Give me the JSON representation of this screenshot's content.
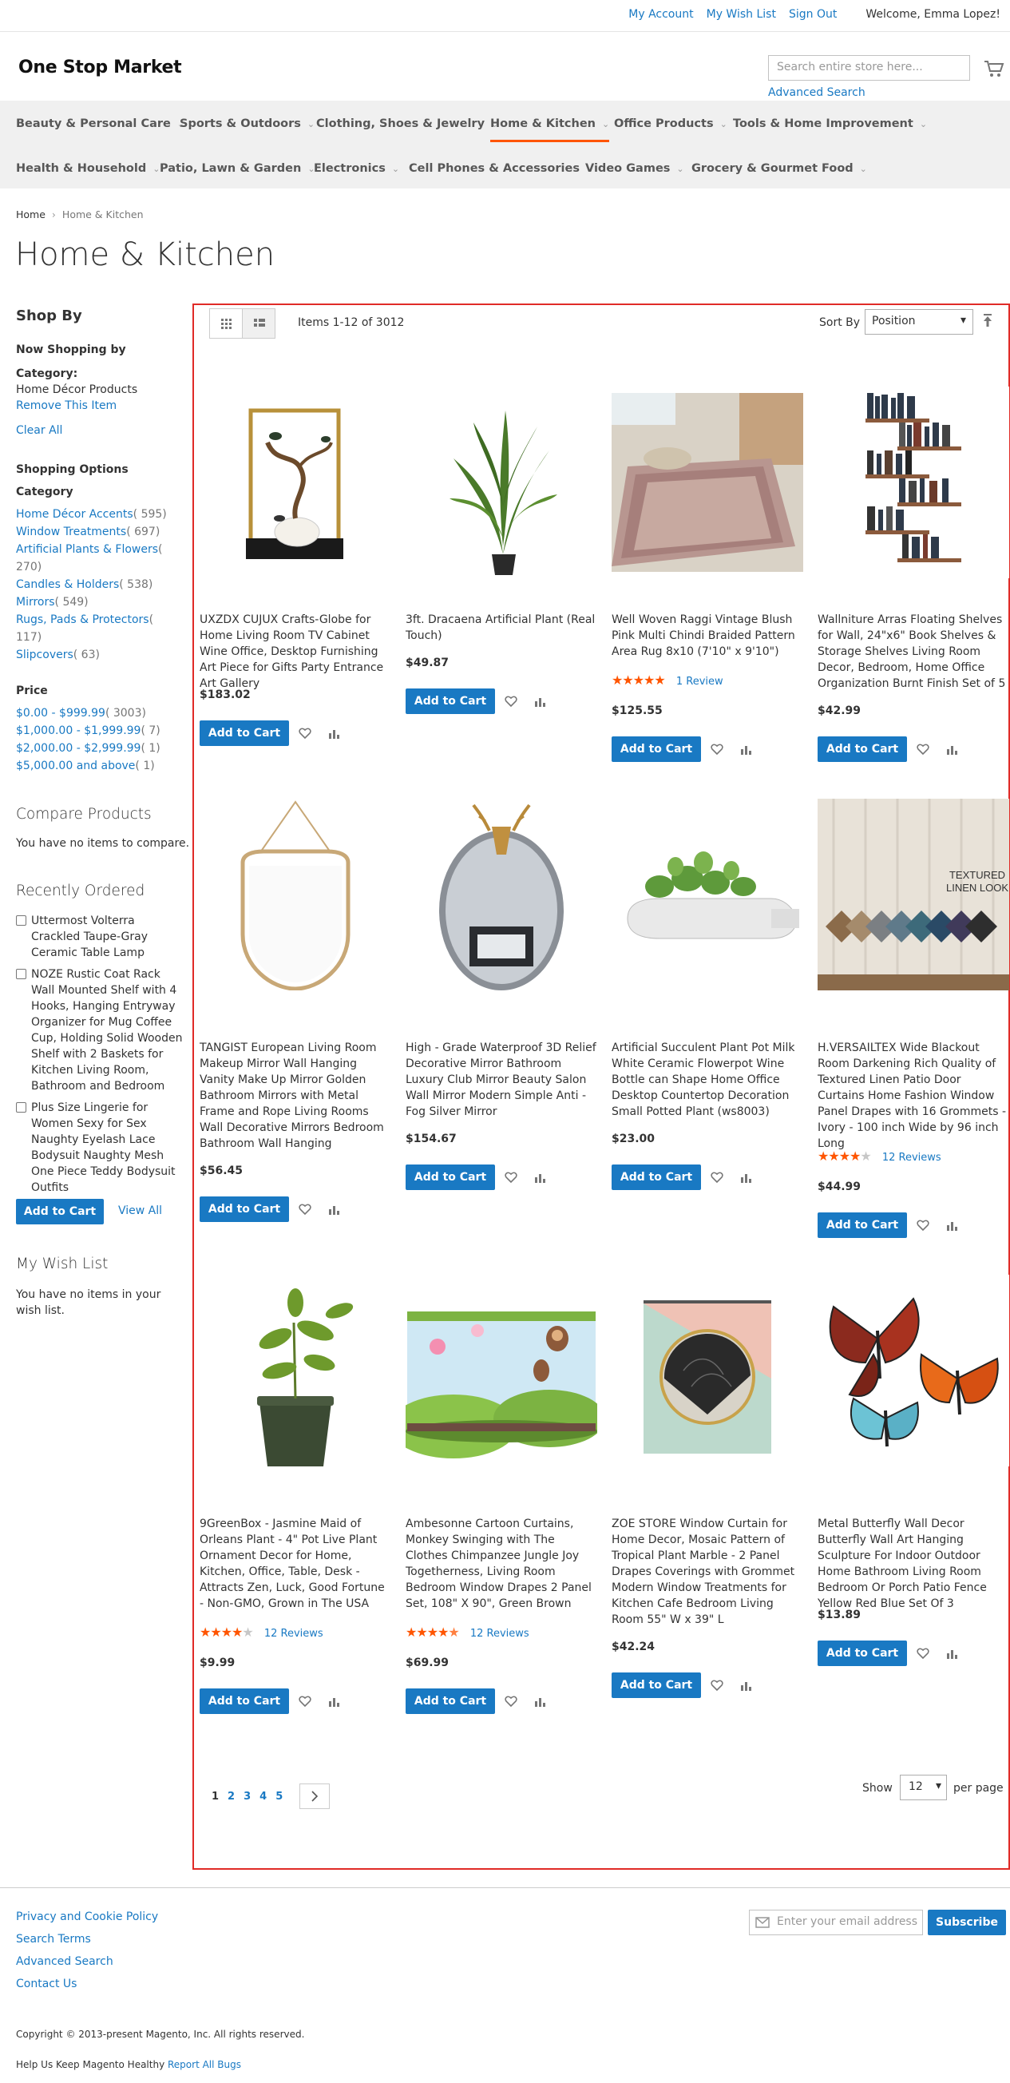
{
  "top": {
    "my_account": "My Account",
    "wish_list": "My Wish List",
    "sign_out": "Sign Out",
    "welcome": "Welcome, Emma Lopez!"
  },
  "header": {
    "logo": "One Stop Market",
    "search_placeholder": "Search entire store here...",
    "advanced_search": "Advanced Search"
  },
  "nav": {
    "items": [
      "Beauty & Personal Care",
      "Sports & Outdoors",
      "Clothing, Shoes & Jewelry",
      "Home & Kitchen",
      "Office Products",
      "Tools & Home Improvement",
      "Health & Household",
      "Patio, Lawn & Garden",
      "Electronics",
      "Cell Phones & Accessories",
      "Video Games",
      "Grocery & Gourmet Food"
    ],
    "active": "Home & Kitchen"
  },
  "breadcrumb": {
    "home": "Home",
    "sep": "›",
    "current": "Home & Kitchen"
  },
  "page_title": "Home & Kitchen",
  "sidebar": {
    "shop_by": "Shop By",
    "now_shopping": "Now Shopping by",
    "category_label": "Category:",
    "category_value": "Home Décor Products",
    "remove": "Remove This Item",
    "clear_all": "Clear All",
    "shopping_options": "Shopping Options",
    "category": "Category",
    "categories": [
      {
        "name": "Home Décor Accents",
        "count": "( 595)"
      },
      {
        "name": "Window Treatments",
        "count": "( 697)"
      },
      {
        "name": "Artificial Plants & Flowers",
        "count": "(",
        "count2": "270)"
      },
      {
        "name": "Candles & Holders",
        "count": "( 538)"
      },
      {
        "name": "Mirrors",
        "count": "( 549)"
      },
      {
        "name": "Rugs, Pads & Protectors",
        "count": "(",
        "count2": "117)"
      },
      {
        "name": "Slipcovers",
        "count": "( 63)"
      }
    ],
    "price": "Price",
    "prices": [
      {
        "name": "$0.00 - $999.99",
        "count": "( 3003)"
      },
      {
        "name": "$1,000.00 - $1,999.99",
        "count": "( 7)"
      },
      {
        "name": "$2,000.00 - $2,999.99",
        "count": "( 1)"
      },
      {
        "name": "$5,000.00 and above",
        "count": "( 1)"
      }
    ],
    "compare_title": "Compare Products",
    "compare_empty": "You have no items to compare.",
    "recent_title": "Recently Ordered",
    "recent_items": [
      "Uttermost Volterra Crackled Taupe-Gray Ceramic Table Lamp",
      "NOZE Rustic Coat Rack Wall Mounted Shelf with 4 Hooks, Hanging Entryway Organizer for Mug Coffee Cup, Holding Solid Wooden Shelf with 2 Baskets for Kitchen Living Room, Bathroom and Bedroom",
      "Plus Size Lingerie for Women Sexy for Sex Naughty Eyelash Lace Bodysuit Naughty Mesh One Piece Teddy Bodysuit Outfits"
    ],
    "add_to_cart": "Add to Cart",
    "view_all": "View All",
    "wish_title": "My Wish List",
    "wish_empty": "You have no items in your wish list."
  },
  "toolbar": {
    "items_count": "Items 1-12 of 3012",
    "sort_by": "Sort By",
    "sort_value": "Position",
    "show": "Show",
    "limit": "12",
    "per_page": "per page",
    "pages": [
      "1",
      "2",
      "3",
      "4",
      "5"
    ]
  },
  "products": [
    {
      "name": "UXZDX CUJUX Crafts-Globe for Home Living Room TV Cabinet Wine Office, Desktop Furnishing Art Piece for Gifts Party Entrance Art Gallery",
      "price": "$183.02",
      "rating": 0,
      "reviews": ""
    },
    {
      "name": "3ft. Dracaena Artificial Plant (Real Touch)",
      "price": "$49.87",
      "rating": 0,
      "reviews": ""
    },
    {
      "name": "Well Woven Raggi Vintage Blush Pink Multi Chindi Braided Pattern Area Rug 8x10 (7'10\" x 9'10\")",
      "price": "$125.55",
      "rating": 5,
      "reviews": "1  Review"
    },
    {
      "name": "Wallniture Arras Floating Shelves for Wall, 24\"x6\" Book Shelves & Storage Shelves Living Room Decor, Bedroom, Home Office Organization Burnt Finish Set of 5",
      "price": "$42.99",
      "rating": 0,
      "reviews": ""
    },
    {
      "name": "TANGIST European Living Room Makeup Mirror Wall Hanging Vanity Make Up Mirror Golden Bathroom Mirrors with Metal Frame and Rope Living Rooms Wall Decorative Mirrors Bedroom Bathroom Wall Hanging",
      "price": "$56.45",
      "rating": 0,
      "reviews": ""
    },
    {
      "name": "High - Grade Waterproof 3D Relief Decorative Mirror Bathroom Luxury Club Mirror Beauty Salon Wall Mirror Modern Simple Anti - Fog Silver Mirror",
      "price": "$154.67",
      "rating": 0,
      "reviews": ""
    },
    {
      "name": "Artificial Succulent Plant Pot Milk White Ceramic Flowerpot Wine Bottle can Shape Home Office Desktop Countertop Decoration Small Potted Plant (ws8003)",
      "price": "$23.00",
      "rating": 0,
      "reviews": ""
    },
    {
      "name": "H.VERSAILTEX Wide Blackout Room Darkening Rich Quality of Textured Linen Patio Door Curtains Home Fashion Window Panel Drapes with 16 Grommets - Ivory - 100 inch Wide by 96 inch Long",
      "price": "$44.99",
      "rating": 4,
      "reviews": "12  Reviews"
    },
    {
      "name": "9GreenBox - Jasmine Maid of Orleans Plant - 4\" Pot Live Plant Ornament Decor for Home, Kitchen, Office, Table, Desk - Attracts Zen, Luck, Good Fortune - Non-GMO, Grown in The USA",
      "price": "$9.99",
      "rating": 4,
      "reviews": "12  Reviews"
    },
    {
      "name": "Ambesonne Cartoon Curtains, Monkey Swinging with The Clothes Chimpanzee Jungle Joy Togetherness, Living Room Bedroom Window Drapes 2 Panel Set, 108\" X 90\", Green Brown",
      "price": "$69.99",
      "rating": 4.5,
      "reviews": "12  Reviews"
    },
    {
      "name": "ZOE STORE Window Curtain for Home Decor, Mosaic Pattern of Tropical Plant Marble - 2 Panel Drapes Coverings with Grommet Modern Window Treatments for Kitchen Cafe Bedroom Living Room 55\" W x 39\" L",
      "price": "$42.24",
      "rating": 0,
      "reviews": ""
    },
    {
      "name": "Metal Butterfly Wall Decor Butterfly Wall Art Hanging Sculpture For Indoor Outdoor Home Bathroom Living Room Bedroom Or Porch Patio Fence Yellow Red Blue Set Of 3",
      "price": "$13.89",
      "rating": 0,
      "reviews": ""
    }
  ],
  "product_button": "Add to Cart",
  "footer": {
    "links": [
      "Privacy and Cookie Policy",
      "Search Terms",
      "Advanced Search",
      "Contact Us"
    ],
    "newsletter_placeholder": "Enter your email address",
    "subscribe": "Subscribe",
    "copyright": "Copyright © 2013-present Magento, Inc. All rights reserved.",
    "healthy": "Help Us Keep Magento Healthy",
    "report": "Report All Bugs"
  },
  "colors": {
    "accent": "#1979c3",
    "active_nav": "#ff5501",
    "frame": "#e02b27",
    "star": "#ff5501"
  }
}
